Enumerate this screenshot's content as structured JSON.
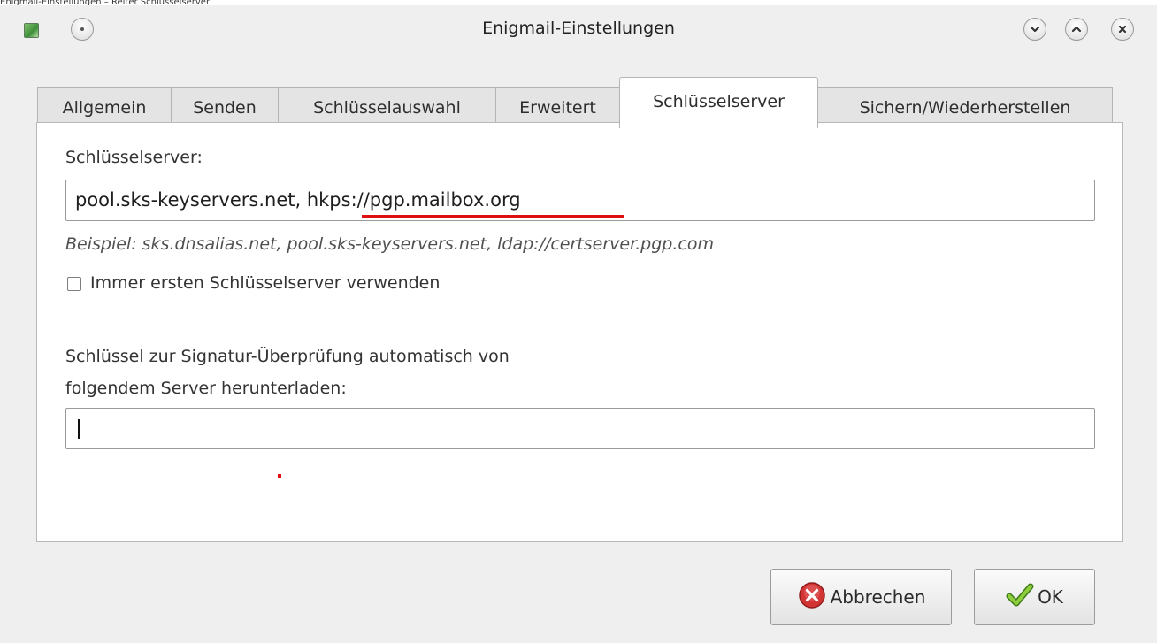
{
  "caption": "Enigmail-Einstellungen – Reiter Schlüsselserver",
  "window": {
    "title": "Enigmail-Einstellungen"
  },
  "tabs": [
    {
      "label": "Allgemein"
    },
    {
      "label": "Senden"
    },
    {
      "label": "Schlüsselauswahl"
    },
    {
      "label": "Erweitert"
    },
    {
      "label": "Schlüsselserver"
    },
    {
      "label": "Sichern/Wiederherstellen"
    }
  ],
  "active_tab": "Schlüsselserver",
  "keyserver": {
    "label": "Schlüsselserver:",
    "value_part1": "pool.sks-keyservers.net, ",
    "value_part2": "hkps://pgp.mailbox.org",
    "example": "Beispiel: sks.dnsalias.net, pool.sks-keyservers.net, ldap://certserver.pgp.com",
    "always_first_label": "Immer ersten Schlüsselserver verwenden",
    "always_first_checked": false
  },
  "autodownload": {
    "label_line1": "Schlüssel zur Signatur-Überprüfung automatisch von",
    "label_line2": "folgendem Server herunterladen:",
    "value": ""
  },
  "buttons": {
    "cancel": "Abbrechen",
    "ok": "OK"
  },
  "colors": {
    "annotation": "#e01010",
    "window_bg": "#efefef"
  },
  "icons": {
    "app": "enigmail-icon",
    "menu": "window-menu-icon",
    "minimize": "chevron-down-icon",
    "maximize": "chevron-up-icon",
    "close": "close-icon",
    "cancel": "cancel-icon",
    "ok": "checkmark-icon"
  }
}
